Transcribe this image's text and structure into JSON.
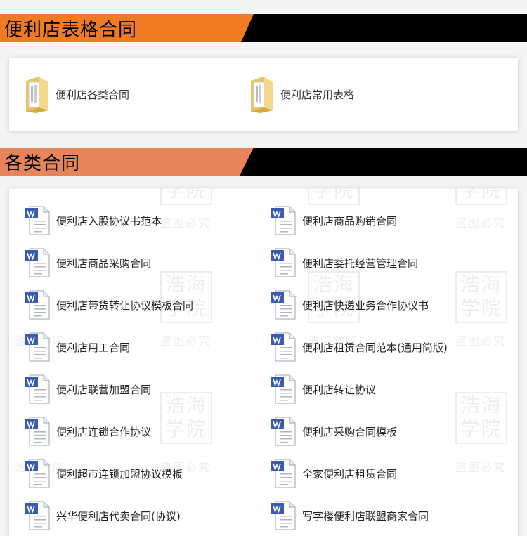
{
  "sections": {
    "forms_title": "便利店表格合同",
    "contracts_title": "各类合同"
  },
  "folders": [
    {
      "label": "便利店各类合同",
      "icon": "folder-icon"
    },
    {
      "label": "便利店常用表格",
      "icon": "folder-icon"
    }
  ],
  "contracts_left": [
    "便利店入股协议书范本",
    "便利店商品采购合同",
    "便利店带货转让协议模板合同",
    "便利店用工合同",
    "便利店联营加盟合同",
    "便利店连锁合作协议",
    "便利超市连锁加盟协议模板",
    "兴华便利店代卖合同(协议)"
  ],
  "contracts_right": [
    "便利店商品购销合同",
    "便利店委托经营管理合同",
    "便利店快递业务合作协议书",
    "便利店租赁合同范本(通用简版)",
    "便利店转让协议",
    "便利店采购合同模板",
    "全家便利店租赁合同",
    "写字楼便利店联盟商家合同"
  ],
  "watermark": {
    "seal_text_top": "浩海",
    "seal_text_bottom": "学院",
    "caption": "盗图必究",
    "caption_alt": "浩海学院"
  },
  "colors": {
    "header_orange": "#f07b25",
    "header_salmon": "#e8845a",
    "doc_blue": "#3a5bb0"
  }
}
